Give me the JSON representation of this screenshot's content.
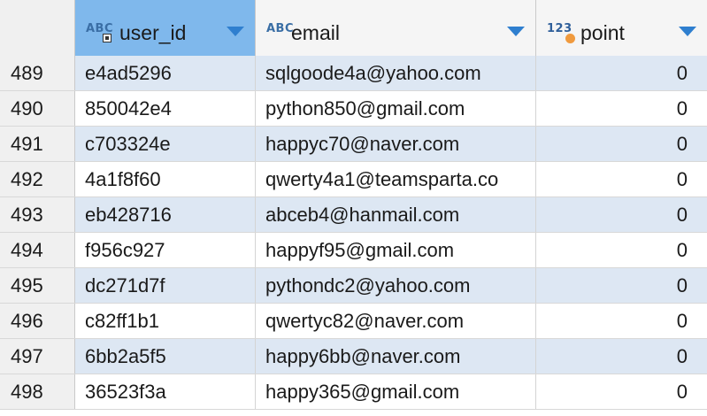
{
  "columns": [
    {
      "label": "user_id",
      "type_badge": "ABC",
      "icon": "key-icon"
    },
    {
      "label": "email",
      "type_badge": "ABC",
      "icon": "text-type-icon"
    },
    {
      "label": "point",
      "type_badge": "123",
      "icon": "number-type-icon"
    }
  ],
  "rows": [
    {
      "num": "489",
      "user_id": "e4ad5296",
      "email": "sqlgoode4a@yahoo.com",
      "point": "0"
    },
    {
      "num": "490",
      "user_id": "850042e4",
      "email": "python850@gmail.com",
      "point": "0"
    },
    {
      "num": "491",
      "user_id": "c703324e",
      "email": "happyc70@naver.com",
      "point": "0"
    },
    {
      "num": "492",
      "user_id": "4a1f8f60",
      "email": "qwerty4a1@teamsparta.co",
      "point": "0"
    },
    {
      "num": "493",
      "user_id": "eb428716",
      "email": "abceb4@hanmail.com",
      "point": "0"
    },
    {
      "num": "494",
      "user_id": "f956c927",
      "email": "happyf95@gmail.com",
      "point": "0"
    },
    {
      "num": "495",
      "user_id": "dc271d7f",
      "email": "pythondc2@yahoo.com",
      "point": "0"
    },
    {
      "num": "496",
      "user_id": "c82ff1b1",
      "email": "qwertyc82@naver.com",
      "point": "0"
    },
    {
      "num": "497",
      "user_id": "6bb2a5f5",
      "email": "happy6bb@naver.com",
      "point": "0"
    },
    {
      "num": "498",
      "user_id": "36523f3a",
      "email": "happy365@gmail.com",
      "point": "0"
    }
  ],
  "colors": {
    "selected_header": "#7fb8ec",
    "alt_row": "#dde7f3",
    "sort_arrow": "#2f7fcf",
    "number_badge_dot": "#f09a3e"
  }
}
